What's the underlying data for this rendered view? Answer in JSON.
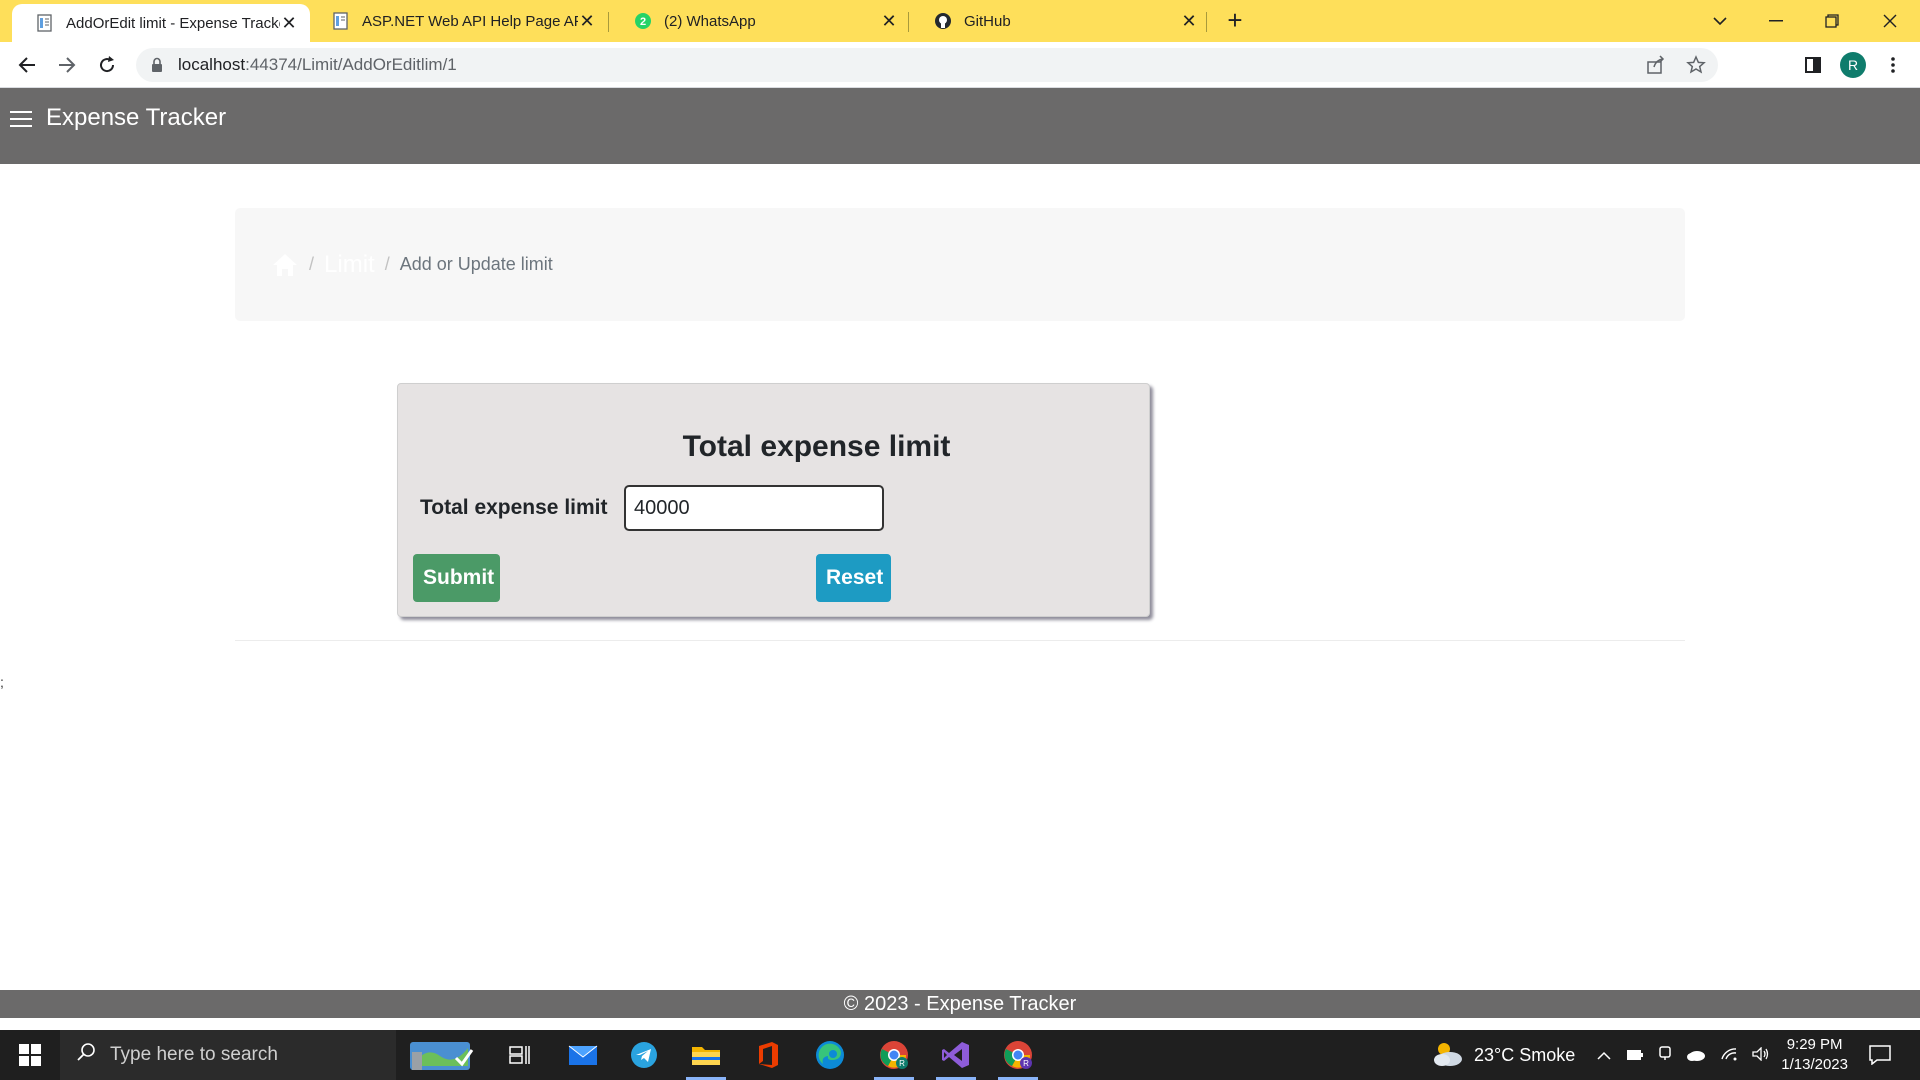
{
  "browser": {
    "tabs": [
      {
        "title": "AddOrEdit limit - Expense Tracker",
        "active": true
      },
      {
        "title": "ASP.NET Web API Help Page API",
        "active": false
      },
      {
        "title": "(2) WhatsApp",
        "active": false,
        "badge": "2"
      },
      {
        "title": "GitHub",
        "active": false
      }
    ],
    "url_host": "localhost",
    "url_path": ":44374/Limit/AddOrEditlim/1",
    "profile_initial": "R"
  },
  "app": {
    "title": "Expense Tracker"
  },
  "breadcrumb": {
    "limit": "Limit",
    "separator": "/",
    "current": "Add or Update limit"
  },
  "form": {
    "title": "Total expense limit",
    "label": "Total expense limit",
    "value": "40000",
    "submit_label": "Submit",
    "reset_label": "Reset"
  },
  "stray_text": ";",
  "footer": {
    "text": "© 2023 - Expense Tracker"
  },
  "taskbar": {
    "search_placeholder": "Type here to search",
    "weather": "23°C  Smoke",
    "time": "9:29 PM",
    "date": "1/13/2023",
    "tray_avatar_initial": "R"
  },
  "colors": {
    "tabstrip": "#fedf5a",
    "header": "#6b6a6a",
    "submit": "#4b9a67",
    "reset": "#1d9bc3",
    "card": "#e6e3e3"
  }
}
